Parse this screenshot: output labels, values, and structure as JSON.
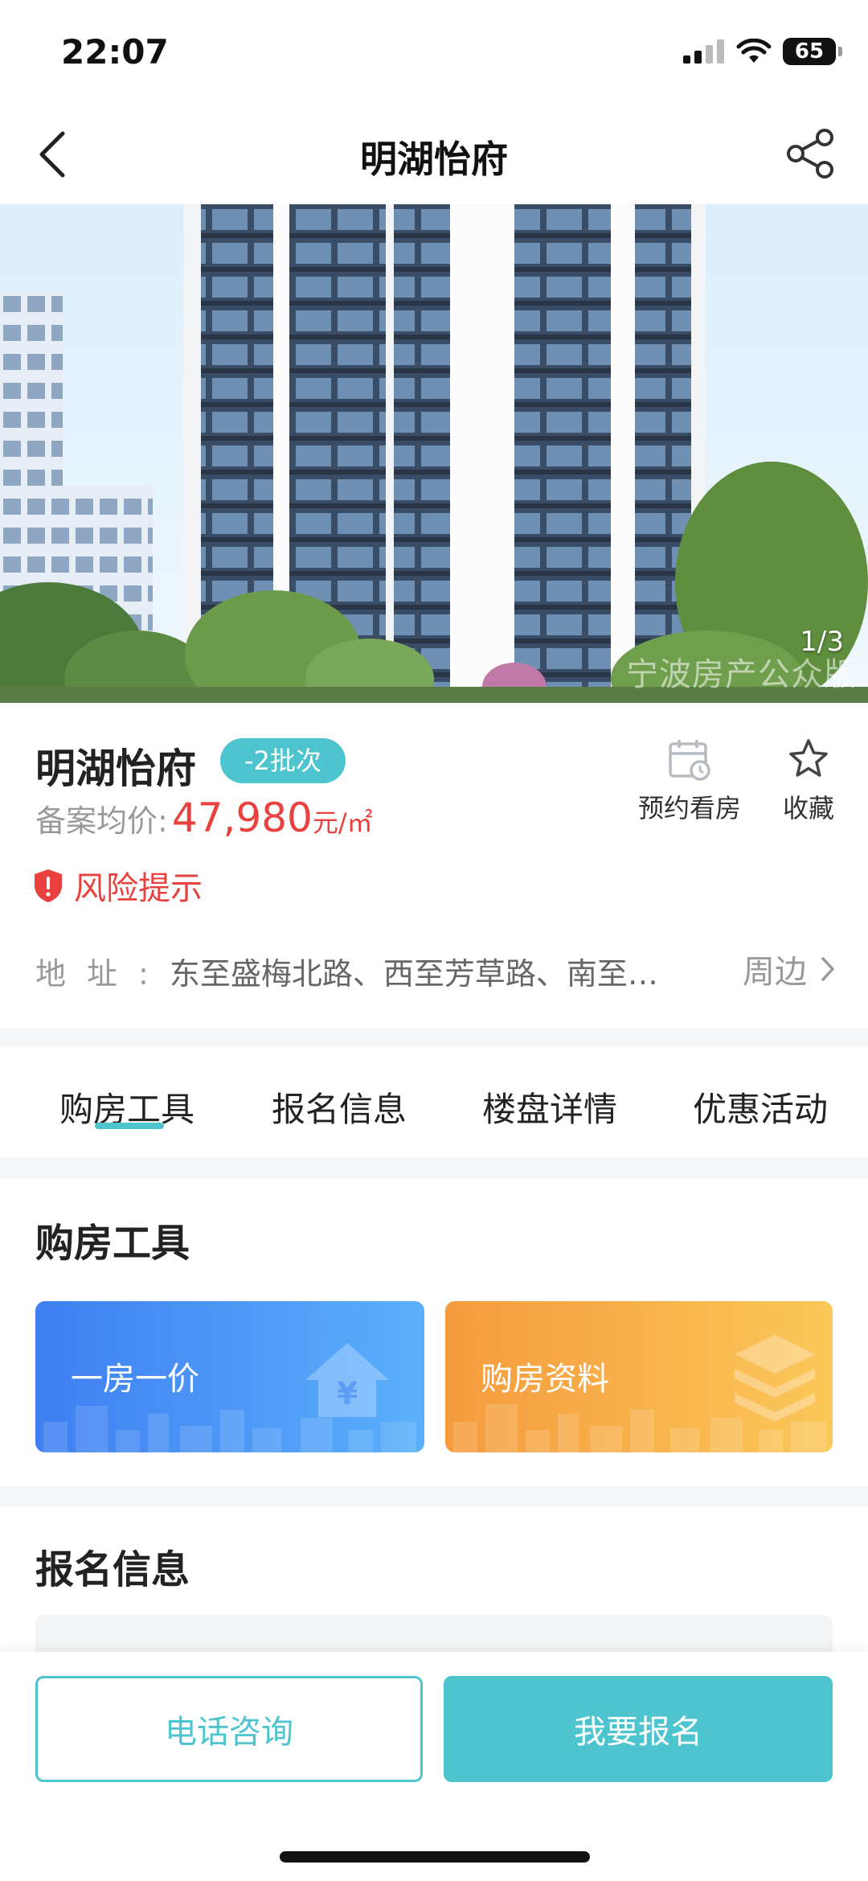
{
  "status_bar": {
    "time": "22:07",
    "battery": "65"
  },
  "nav": {
    "title": "明湖怡府"
  },
  "gallery": {
    "counter": "1/3",
    "watermark": "宁波房产公众版"
  },
  "project": {
    "name": "明湖怡府",
    "batch": "-2批次",
    "price_label": "备案均价:",
    "price_value": "47,980",
    "price_unit": "元/㎡",
    "risk_label": "风险提示",
    "address_label": "地址:",
    "address_text": "东至盛梅北路、西至芳草路、南至…",
    "nearby_label": "周边"
  },
  "actions": {
    "appointment": "预约看房",
    "favorite": "收藏"
  },
  "tabs": [
    "购房工具",
    "报名信息",
    "楼盘详情",
    "优惠活动"
  ],
  "tools": {
    "title": "购房工具",
    "items": [
      {
        "label": "一房一价",
        "icon": "house-yuan-icon"
      },
      {
        "label": "购房资料",
        "icon": "layers-icon"
      }
    ]
  },
  "signup": {
    "title": "报名信息"
  },
  "bottom": {
    "call": "电话咨询",
    "register": "我要报名"
  },
  "colors": {
    "accent": "#4ec4cf",
    "price": "#e8413e",
    "blue_card": "#3e86f5",
    "orange_card": "#f6a442"
  }
}
